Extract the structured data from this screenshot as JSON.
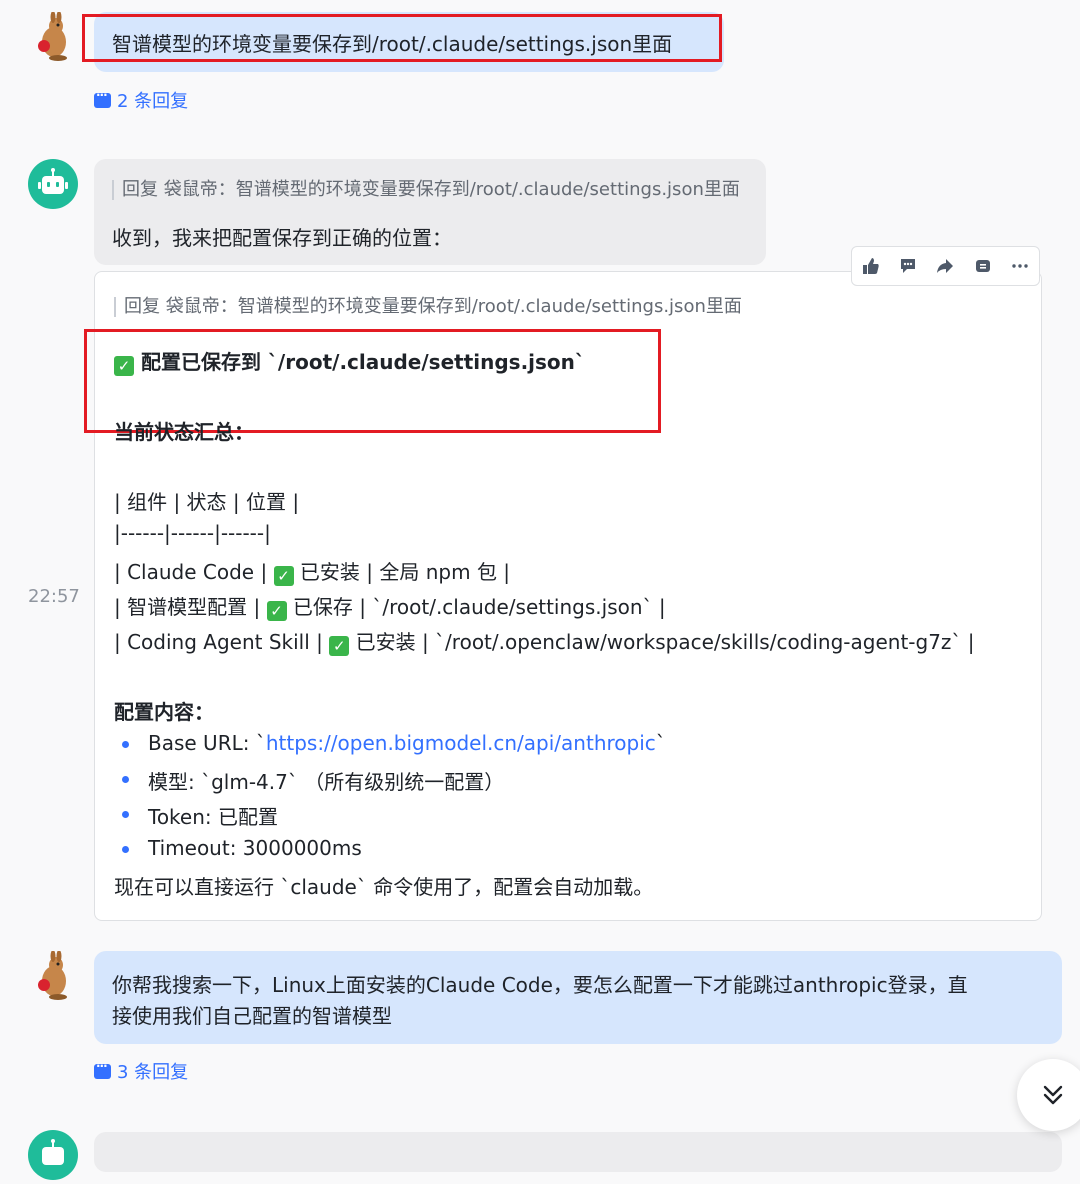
{
  "messages": [
    {
      "text": "智谱模型的环境变量要保存到/root/.claude/settings.json里面",
      "reply_count": "2 条回复"
    },
    {
      "quote": "回复 袋鼠帝：智谱模型的环境变量要保存到/root/.claude/settings.json里面",
      "text": "收到，我来把配置保存到正确的位置："
    },
    {
      "quote": "回复 袋鼠帝：智谱模型的环境变量要保存到/root/.claude/settings.json里面",
      "saved_line": "配置已保存到 `/root/.claude/settings.json`",
      "status_heading": "当前状态汇总：",
      "table_lines": [
        "| 组件 | 状态 | 位置 |",
        "|------|------|------|"
      ],
      "row1": {
        "pre": "| Claude Code |",
        "post": "已安装 | 全局 npm 包 |"
      },
      "row2": {
        "pre": "| 智谱模型配置 |",
        "post": "已保存 | `/root/.claude/settings.json` |"
      },
      "row3": {
        "pre": "| Coding Agent Skill |",
        "post": "已安装 | `/root/.openclaw/workspace/skills/coding-agent-g7z` |"
      },
      "config_heading": "配置内容：",
      "bullets": {
        "base_url_label": "Base URL: `",
        "base_url_link": "https://open.bigmodel.cn/api/anthropic",
        "base_url_end": "`",
        "model": "模型: `glm-4.7` （所有级别统一配置）",
        "token": "Token: 已配置",
        "timeout": "Timeout: 3000000ms"
      },
      "footer": "现在可以直接运行 `claude` 命令使用了，配置会自动加载。"
    },
    {
      "text_line1": "你帮我搜索一下，Linux上面安装的Claude Code，要怎么配置一下才能跳过anthropic登录，直",
      "text_line2": "接使用我们自己配置的智谱模型",
      "reply_count": "3 条回复"
    }
  ],
  "timestamp": "22:57",
  "check_mark": "✓",
  "colors": {
    "accent": "#3370ff",
    "highlight": "#e31b23",
    "bot": "#1fbc9a"
  },
  "icons": [
    "thumbs-up-icon",
    "comment-icon",
    "forward-icon",
    "pin-icon",
    "more-icon",
    "double-chevron-down-icon"
  ]
}
